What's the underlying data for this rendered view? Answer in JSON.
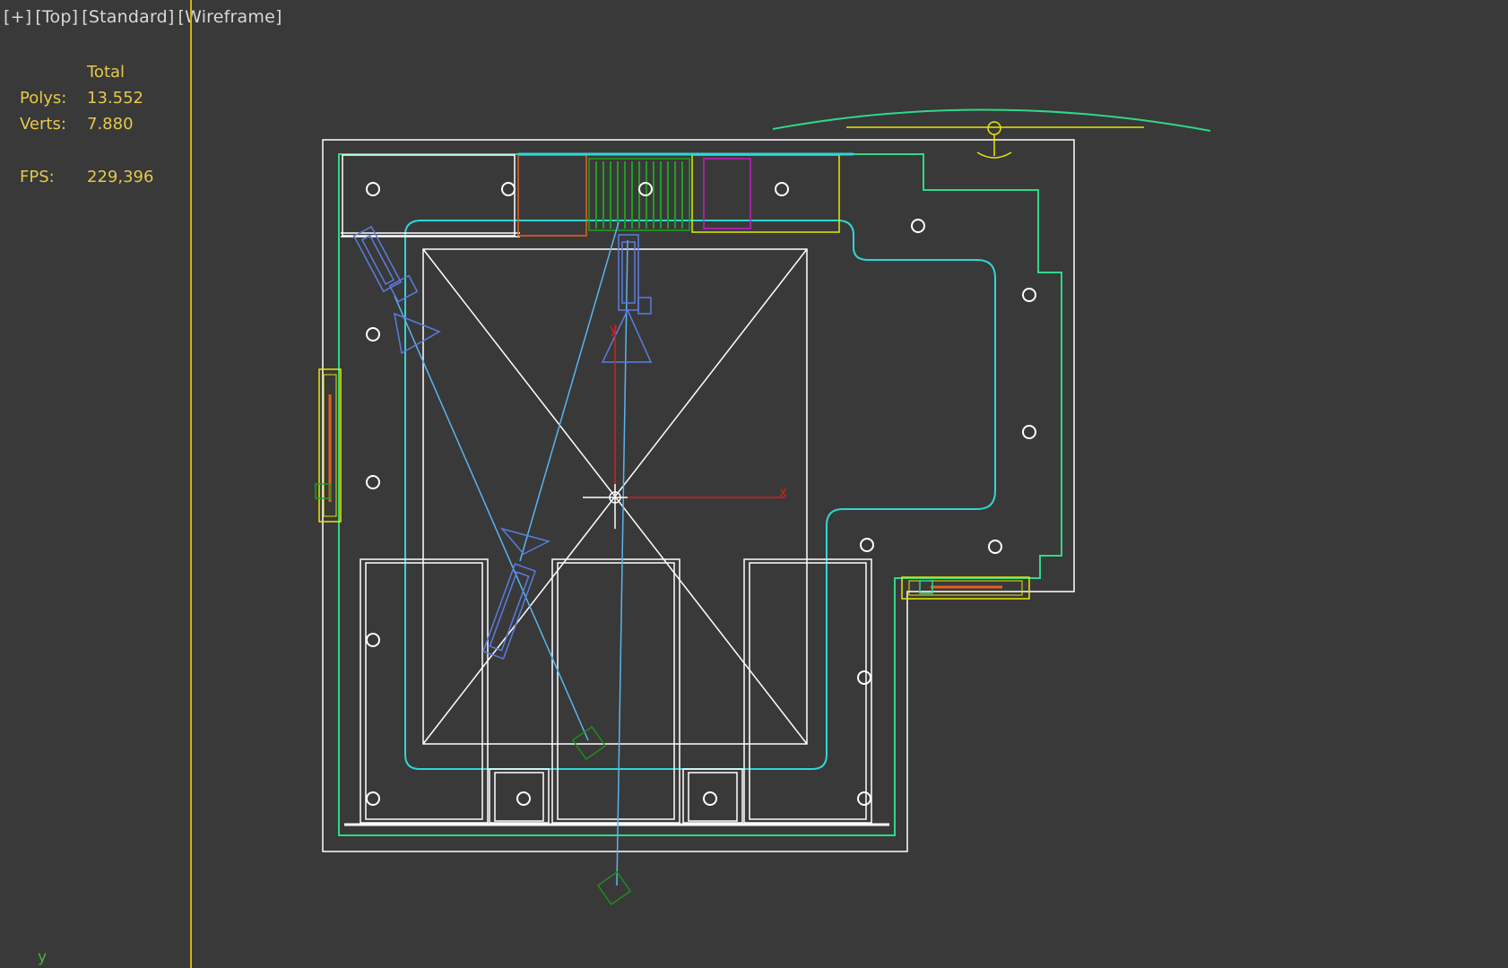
{
  "viewport": {
    "labels": [
      "[+]",
      "[Top]",
      "[Standard]",
      "[Wireframe]"
    ]
  },
  "stats": {
    "header": "Total",
    "polys_label": "Polys:",
    "polys_value": "13.552",
    "verts_label": "Verts:",
    "verts_value": "7.880",
    "fps_label": "FPS:",
    "fps_value": "229,396"
  },
  "axes": {
    "x_label": "x",
    "y_label": "y",
    "y_world_label": "y"
  },
  "colors": {
    "background": "#393939",
    "wall": "#ffffff",
    "cyan": "#2ed6d6",
    "green": "#2fd88a",
    "yellow": "#e8e800",
    "blue_camera": "#5a7de0",
    "light_blue_target": "#5ab4f0",
    "red_axis": "#d02020",
    "dark_green": "#1e8c1e"
  }
}
